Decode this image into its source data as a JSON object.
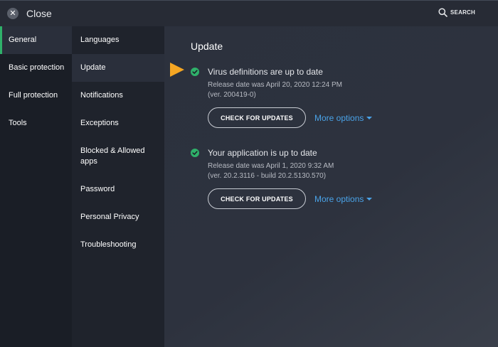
{
  "header": {
    "close_label": "Close",
    "close_icon": "close-icon",
    "search_label": "SEARCH",
    "search_icon": "search-icon"
  },
  "primary_nav": {
    "items": [
      {
        "label": "General",
        "active": true
      },
      {
        "label": "Basic protection",
        "active": false
      },
      {
        "label": "Full protection",
        "active": false
      },
      {
        "label": "Tools",
        "active": false
      }
    ]
  },
  "secondary_nav": {
    "items": [
      {
        "label": "Languages",
        "active": false
      },
      {
        "label": "Update",
        "active": true
      },
      {
        "label": "Notifications",
        "active": false
      },
      {
        "label": "Exceptions",
        "active": false
      },
      {
        "label": "Blocked & Allowed apps",
        "active": false
      },
      {
        "label": "Password",
        "active": false
      },
      {
        "label": "Personal Privacy",
        "active": false
      },
      {
        "label": "Troubleshooting",
        "active": false
      }
    ]
  },
  "main": {
    "title": "Update",
    "sections": [
      {
        "status": "Virus definitions are up to date",
        "release": "Release date was April 20, 2020 12:24 PM",
        "version": "(ver. 200419-0)",
        "button_label": "CHECK FOR UPDATES",
        "more_label": "More options"
      },
      {
        "status": "Your application is up to date",
        "release": "Release date was April 1, 2020 9:32 AM",
        "version": "(ver. 20.2.3116 - build 20.2.5130.570)",
        "button_label": "CHECK FOR UPDATES",
        "more_label": "More options"
      }
    ]
  },
  "colors": {
    "accent_green": "#2fb16a",
    "link_blue": "#4aa3e8",
    "arrow_orange": "#f5a623"
  }
}
